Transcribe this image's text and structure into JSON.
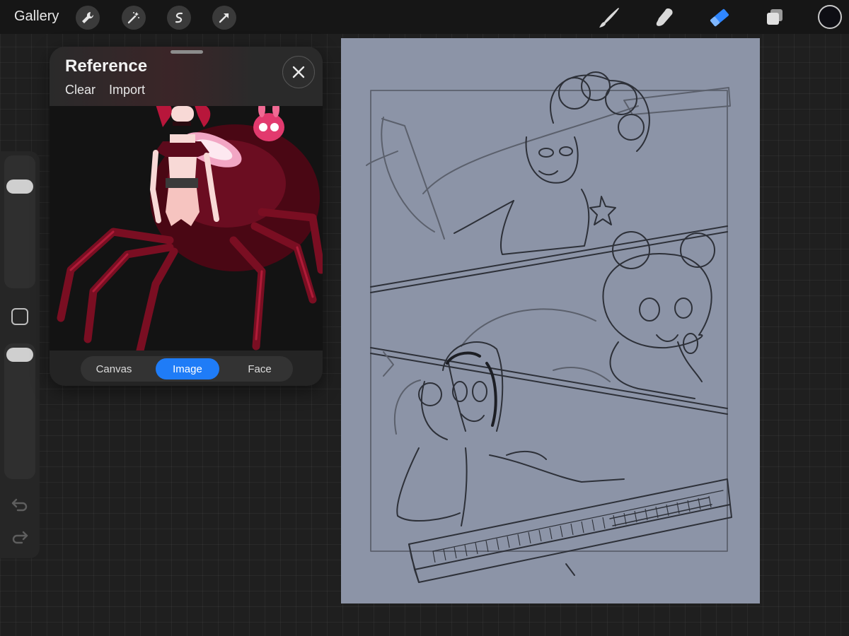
{
  "toolbar": {
    "gallery_label": "Gallery",
    "left_tools": [
      "wrench-icon",
      "magic-wand-icon",
      "selection-icon",
      "transform-arrow-icon"
    ],
    "right_tools": [
      "brush-icon",
      "smudge-icon",
      "eraser-icon",
      "layers-icon"
    ],
    "active_tool": "eraser-icon",
    "current_color": "#0e0e14"
  },
  "sidebar": {
    "brush_size": 0.85,
    "brush_opacity": 0.95,
    "items": [
      "size-slider",
      "modify-button",
      "opacity-slider",
      "undo-icon",
      "redo-icon"
    ]
  },
  "reference": {
    "title": "Reference",
    "clear_label": "Clear",
    "import_label": "Import",
    "tabs": [
      {
        "label": "Canvas",
        "active": false
      },
      {
        "label": "Image",
        "active": true
      },
      {
        "label": "Face",
        "active": false
      }
    ],
    "image_subject": "spider-girl character illustration"
  },
  "canvas": {
    "background": "#8c94a7",
    "content": "three-panel comic sketch"
  },
  "colors": {
    "accent": "#1f7cf7",
    "toolbar_bg": "#161616",
    "panel_bg": "#242424",
    "workspace_bg": "#1f1f1f"
  }
}
